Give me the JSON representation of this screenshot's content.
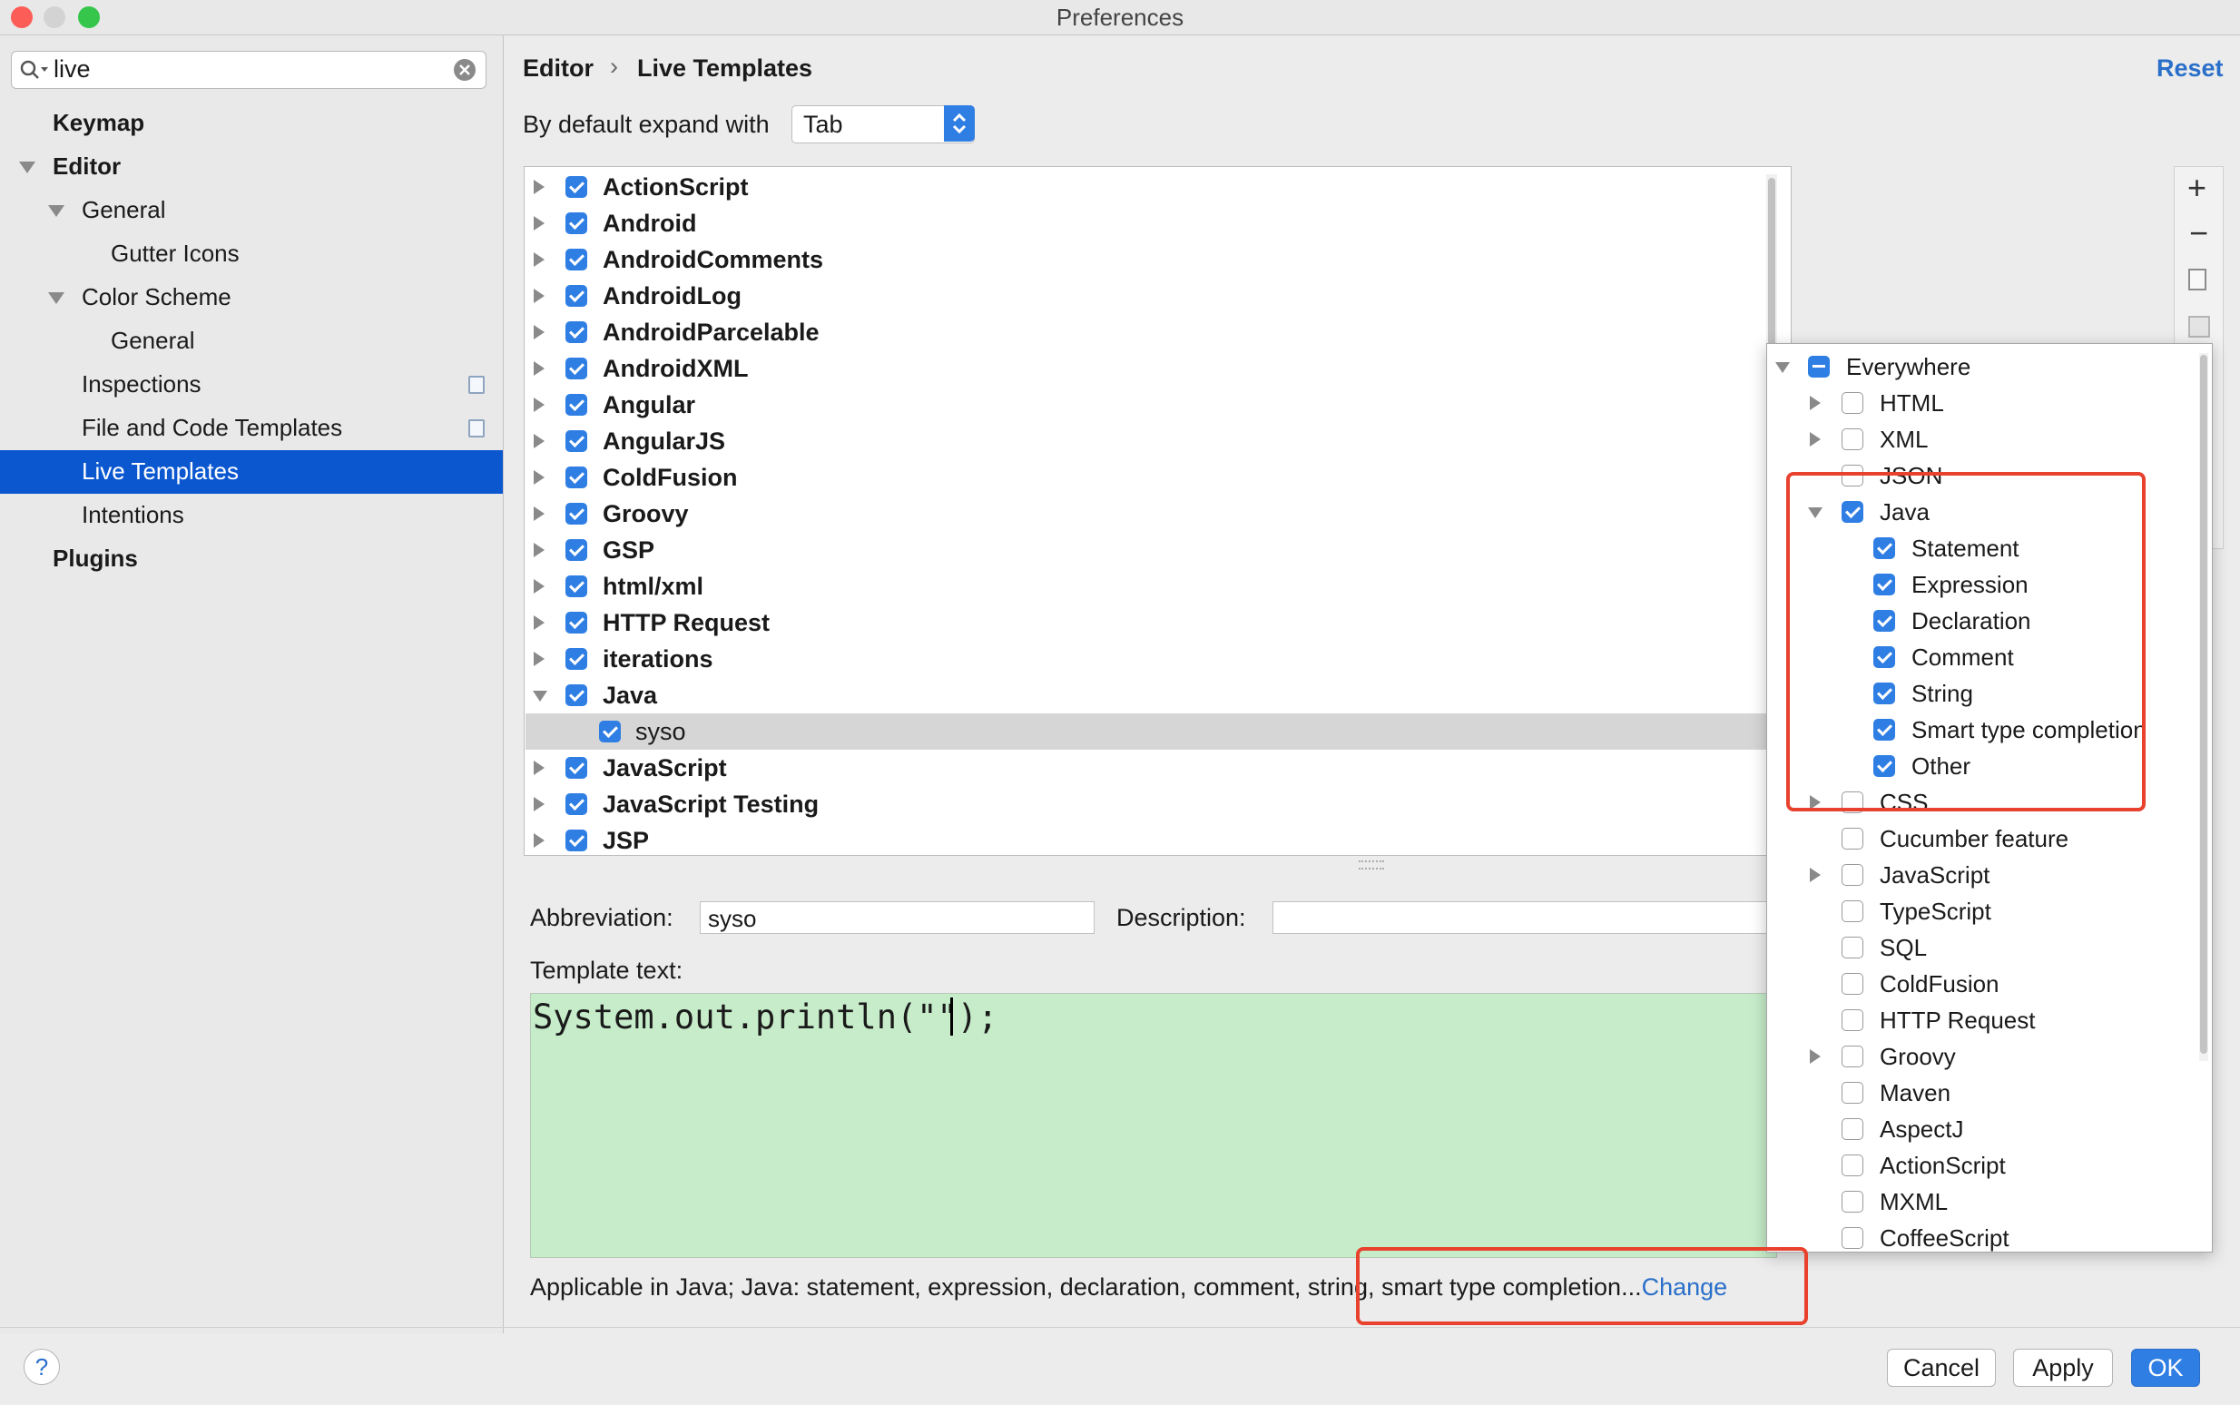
{
  "window": {
    "title": "Preferences"
  },
  "search": {
    "value": "live"
  },
  "sidebar": {
    "items": [
      {
        "label": "Keymap"
      },
      {
        "label": "Editor"
      },
      {
        "label": "General"
      },
      {
        "label": "Gutter Icons"
      },
      {
        "label": "Color Scheme"
      },
      {
        "label": "General"
      },
      {
        "label": "Inspections"
      },
      {
        "label": "File and Code Templates"
      },
      {
        "label": "Live Templates"
      },
      {
        "label": "Intentions"
      },
      {
        "label": "Plugins"
      }
    ]
  },
  "header": {
    "crumb1": "Editor",
    "sep": "›",
    "crumb2": "Live Templates",
    "reset": "Reset"
  },
  "expand": {
    "label": "By default expand with",
    "value": "Tab"
  },
  "template_groups": [
    {
      "label": "ActionScript"
    },
    {
      "label": "Android"
    },
    {
      "label": "AndroidComments"
    },
    {
      "label": "AndroidLog"
    },
    {
      "label": "AndroidParcelable"
    },
    {
      "label": "AndroidXML"
    },
    {
      "label": "Angular"
    },
    {
      "label": "AngularJS"
    },
    {
      "label": "ColdFusion"
    },
    {
      "label": "Groovy"
    },
    {
      "label": "GSP"
    },
    {
      "label": "html/xml"
    },
    {
      "label": "HTTP Request"
    },
    {
      "label": "iterations"
    },
    {
      "label": "Java"
    },
    {
      "label": "syso"
    },
    {
      "label": "JavaScript"
    },
    {
      "label": "JavaScript Testing"
    },
    {
      "label": "JSP"
    }
  ],
  "toolbar": {
    "add": "+",
    "remove": "−"
  },
  "editor": {
    "abbreviation_label": "Abbreviation:",
    "abbreviation_value": "syso",
    "description_label": "Description:",
    "template_label": "Template text:",
    "template_text": "System.out.println(\"\");",
    "applicable_text": "Applicable in Java; Java: statement, expression, declaration, comment, string, smart type completion...",
    "change_link": "Change"
  },
  "contexts": [
    {
      "label": "Everywhere"
    },
    {
      "label": "HTML"
    },
    {
      "label": "XML"
    },
    {
      "label": "JSON"
    },
    {
      "label": "Java"
    },
    {
      "label": "Statement"
    },
    {
      "label": "Expression"
    },
    {
      "label": "Declaration"
    },
    {
      "label": "Comment"
    },
    {
      "label": "String"
    },
    {
      "label": "Smart type completion"
    },
    {
      "label": "Other"
    },
    {
      "label": "CSS"
    },
    {
      "label": "Cucumber feature"
    },
    {
      "label": "JavaScript"
    },
    {
      "label": "TypeScript"
    },
    {
      "label": "SQL"
    },
    {
      "label": "ColdFusion"
    },
    {
      "label": "HTTP Request"
    },
    {
      "label": "Groovy"
    },
    {
      "label": "Maven"
    },
    {
      "label": "AspectJ"
    },
    {
      "label": "ActionScript"
    },
    {
      "label": "MXML"
    },
    {
      "label": "CoffeeScript"
    }
  ],
  "buttons": {
    "help": "?",
    "cancel": "Cancel",
    "apply": "Apply",
    "ok": "OK"
  },
  "colors": {
    "accent": "#2f7ee4",
    "selection": "#0b57d0",
    "template_bg": "#c6ecca",
    "highlight": "#e8412e"
  }
}
